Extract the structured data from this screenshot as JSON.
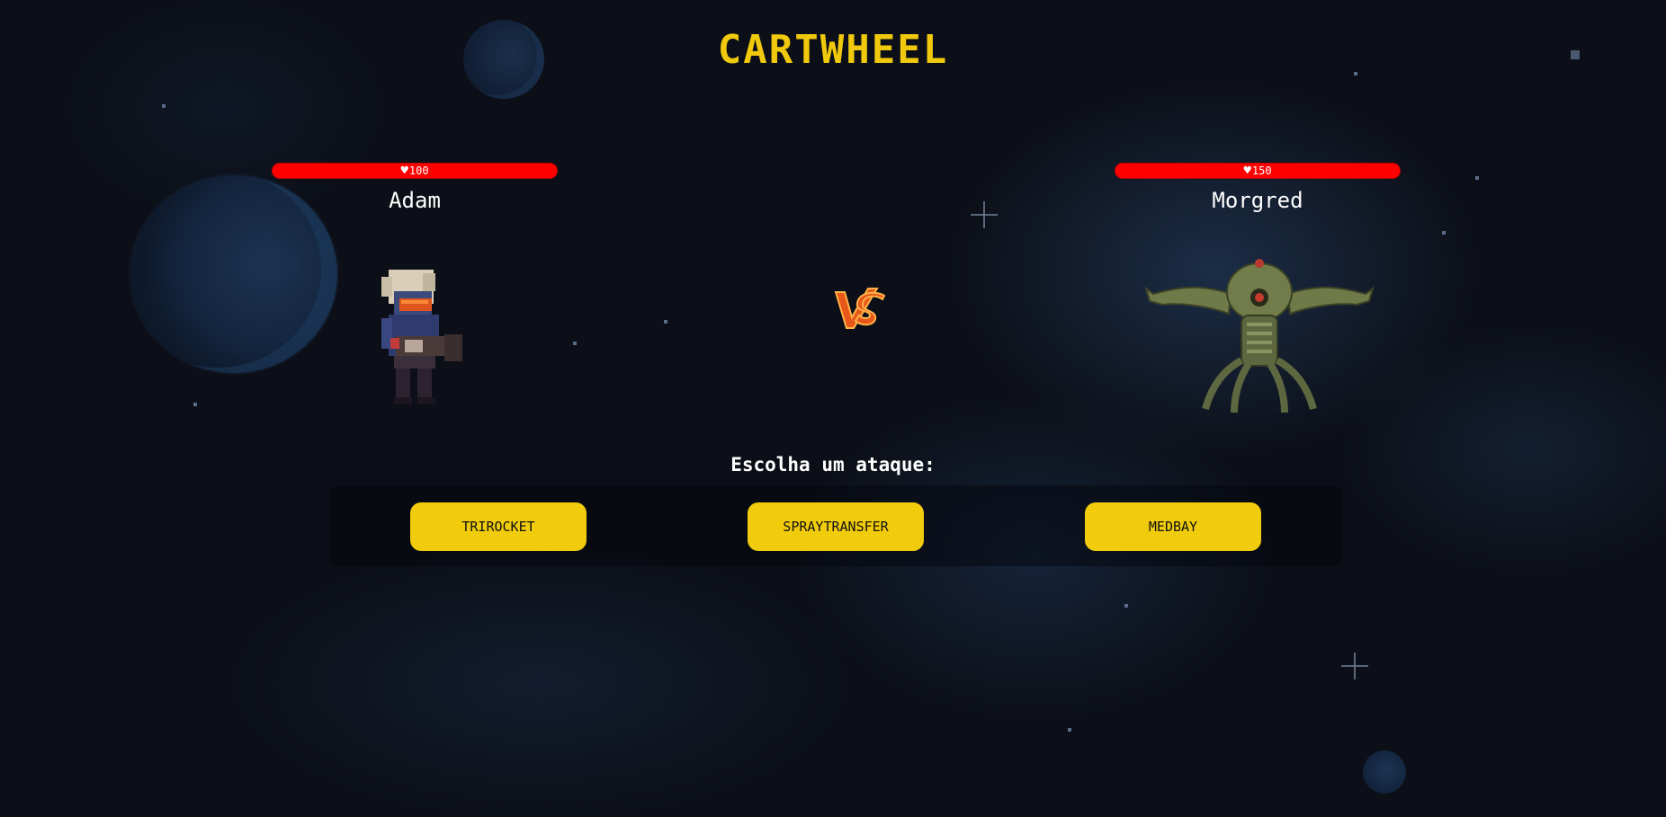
{
  "game": {
    "title": "CARTWHEEL",
    "vs_text": "VS",
    "prompt": "Escolha um ataque:"
  },
  "player": {
    "name": "Adam",
    "hp": "100"
  },
  "enemy": {
    "name": "Morgred",
    "hp": "150"
  },
  "attacks": [
    {
      "label": "TRIROCKET"
    },
    {
      "label": "SPRAYTRANSFER"
    },
    {
      "label": "MEDBAY"
    }
  ],
  "colors": {
    "accent": "#f0cc0c",
    "hp_bar": "#ff0000",
    "background": "#0c0f17"
  },
  "icons": {
    "hp": "heart-icon",
    "versus": "vs-icon"
  }
}
